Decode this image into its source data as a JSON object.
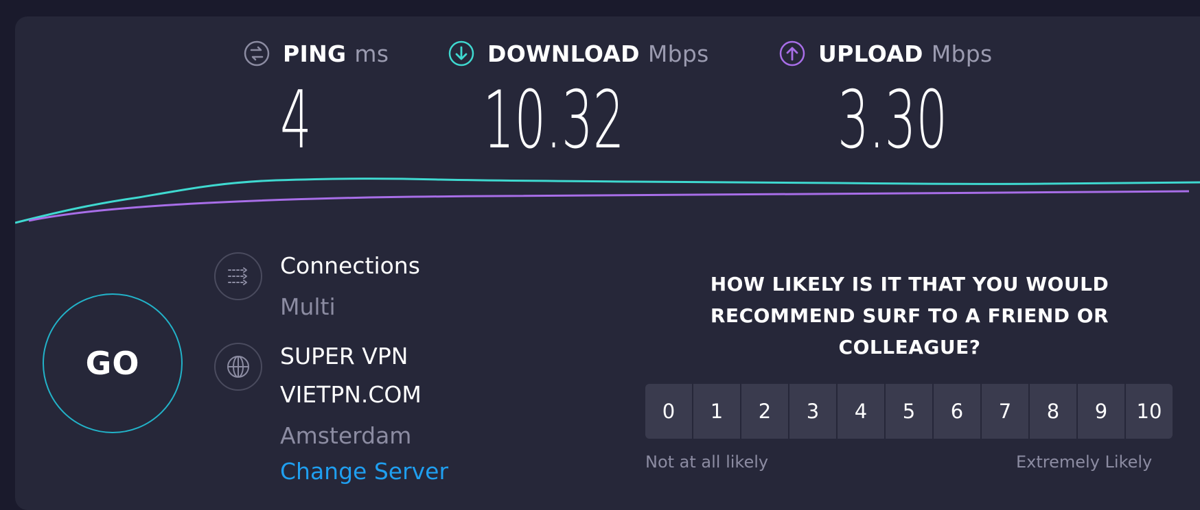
{
  "metrics": {
    "ping": {
      "label": "PING",
      "unit": "ms",
      "value": "4",
      "icon": "ping-icon"
    },
    "download": {
      "label": "DOWNLOAD",
      "unit": "Mbps",
      "value": "10.32",
      "icon": "download-arrow-icon",
      "color": "#3fd9d0"
    },
    "upload": {
      "label": "UPLOAD",
      "unit": "Mbps",
      "value": "3.30",
      "icon": "upload-arrow-icon",
      "color": "#a86ee8"
    }
  },
  "go_button": {
    "label": "GO",
    "ring_color": "#22b3c9"
  },
  "connections": {
    "title": "Connections",
    "mode": "Multi",
    "icon": "connections-icon"
  },
  "server": {
    "provider": "SUPER VPN",
    "host": "VIETPN.COM",
    "location": "Amsterdam",
    "change_label": "Change Server",
    "icon": "globe-icon"
  },
  "survey": {
    "question_lines": [
      "HOW LIKELY IS IT THAT YOU WOULD",
      "RECOMMEND SURF TO A FRIEND OR",
      "COLLEAGUE?"
    ],
    "scale": [
      "0",
      "1",
      "2",
      "3",
      "4",
      "5",
      "6",
      "7",
      "8",
      "9",
      "10"
    ],
    "low_label": "Not at all likely",
    "high_label": "Extremely Likely"
  },
  "colors": {
    "background": "#1a1a2c",
    "card": "#262739",
    "accent_link": "#1f9ff0"
  }
}
